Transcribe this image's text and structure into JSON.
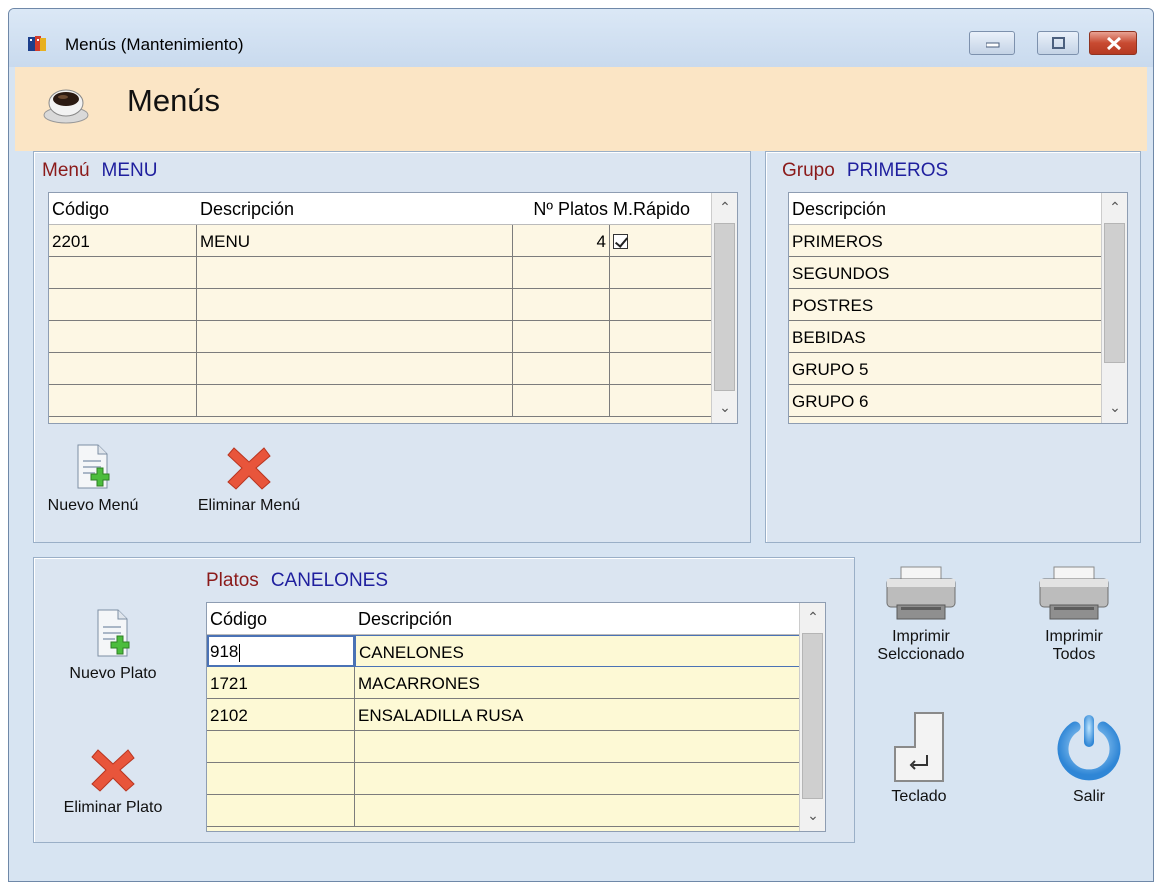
{
  "window": {
    "title": "Menús (Mantenimiento)"
  },
  "header": {
    "title": "Menús"
  },
  "menu_panel": {
    "caption_label": "Menú",
    "caption_value": "MENU",
    "columns": [
      "Código",
      "Descripción",
      "Nº Platos",
      "M.Rápido"
    ],
    "rows": [
      {
        "codigo": "2201",
        "descripcion": "MENU",
        "platos": "4",
        "rapido": true
      }
    ],
    "new_label": "Nuevo Menú",
    "delete_label": "Eliminar Menú"
  },
  "group_panel": {
    "caption_label": "Grupo",
    "caption_value": "PRIMEROS",
    "column": "Descripción",
    "items": [
      "PRIMEROS",
      "SEGUNDOS",
      "POSTRES",
      "BEBIDAS",
      "GRUPO 5",
      "GRUPO 6"
    ]
  },
  "dishes_panel": {
    "caption_label": "Platos",
    "caption_value": "CANELONES",
    "columns": [
      "Código",
      "Descripción"
    ],
    "rows": [
      {
        "codigo": "918",
        "descripcion": "CANELONES"
      },
      {
        "codigo": "1721",
        "descripcion": "MACARRONES"
      },
      {
        "codigo": "2102",
        "descripcion": "ENSALADILLA RUSA"
      }
    ],
    "new_label": "Nuevo Plato",
    "delete_label": "Eliminar Plato"
  },
  "actions": {
    "print_selected_line1": "Imprimir",
    "print_selected_line2": "Selccionado",
    "print_all_line1": "Imprimir",
    "print_all_line2": "Todos",
    "keyboard": "Teclado",
    "exit": "Salir"
  }
}
